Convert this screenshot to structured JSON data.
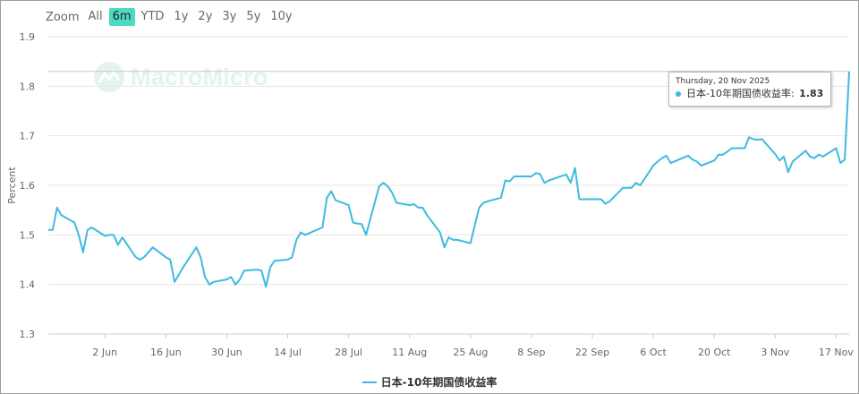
{
  "range_selector": {
    "zoom_label": "Zoom",
    "buttons": [
      "All",
      "6m",
      "YTD",
      "1y",
      "2y",
      "3y",
      "5y",
      "10y"
    ],
    "active": "6m"
  },
  "watermark": {
    "text": "MacroMicro"
  },
  "tooltip": {
    "date": "Thursday, 20 Nov 2025",
    "series_name": "日本-10年期国债收益率",
    "separator": ": ",
    "value": "1.83"
  },
  "colors": {
    "series": "#3ebae0",
    "active_button": "#4dd9c2",
    "grid": "#e6e6e6"
  },
  "chart_data": {
    "type": "line",
    "ylabel": "Percent",
    "xlabel": "",
    "ylim": [
      1.3,
      1.9
    ],
    "yticks": [
      1.3,
      1.4,
      1.5,
      1.6,
      1.7,
      1.8,
      1.9
    ],
    "grid": "horizontal",
    "legend_position": "bottom-center",
    "xlim": [
      "2025-05-20",
      "2025-11-20"
    ],
    "xticks": [
      {
        "date": "2025-06-02",
        "label": "2 Jun"
      },
      {
        "date": "2025-06-16",
        "label": "16 Jun"
      },
      {
        "date": "2025-06-30",
        "label": "30 Jun"
      },
      {
        "date": "2025-07-14",
        "label": "14 Jul"
      },
      {
        "date": "2025-07-28",
        "label": "28 Jul"
      },
      {
        "date": "2025-08-11",
        "label": "11 Aug"
      },
      {
        "date": "2025-08-25",
        "label": "25 Aug"
      },
      {
        "date": "2025-09-08",
        "label": "8 Sep"
      },
      {
        "date": "2025-09-22",
        "label": "22 Sep"
      },
      {
        "date": "2025-10-06",
        "label": "6 Oct"
      },
      {
        "date": "2025-10-20",
        "label": "20 Oct"
      },
      {
        "date": "2025-11-03",
        "label": "3 Nov"
      },
      {
        "date": "2025-11-17",
        "label": "17 Nov"
      }
    ],
    "series": [
      {
        "name": "日本-10年期国债收益率",
        "points": [
          [
            "2025-05-20",
            1.51
          ],
          [
            "2025-05-21",
            1.51
          ],
          [
            "2025-05-22",
            1.555
          ],
          [
            "2025-05-23",
            1.54
          ],
          [
            "2025-05-26",
            1.525
          ],
          [
            "2025-05-27",
            1.5
          ],
          [
            "2025-05-28",
            1.465
          ],
          [
            "2025-05-29",
            1.51
          ],
          [
            "2025-05-30",
            1.515
          ],
          [
            "2025-06-02",
            1.498
          ],
          [
            "2025-06-03",
            1.5
          ],
          [
            "2025-06-04",
            1.5
          ],
          [
            "2025-06-05",
            1.48
          ],
          [
            "2025-06-06",
            1.495
          ],
          [
            "2025-06-09",
            1.456
          ],
          [
            "2025-06-10",
            1.45
          ],
          [
            "2025-06-11",
            1.455
          ],
          [
            "2025-06-12",
            1.465
          ],
          [
            "2025-06-13",
            1.475
          ],
          [
            "2025-06-16",
            1.455
          ],
          [
            "2025-06-17",
            1.45
          ],
          [
            "2025-06-18",
            1.405
          ],
          [
            "2025-06-19",
            1.42
          ],
          [
            "2025-06-20",
            1.435
          ],
          [
            "2025-06-23",
            1.475
          ],
          [
            "2025-06-24",
            1.455
          ],
          [
            "2025-06-25",
            1.415
          ],
          [
            "2025-06-26",
            1.4
          ],
          [
            "2025-06-27",
            1.405
          ],
          [
            "2025-06-30",
            1.41
          ],
          [
            "2025-07-01",
            1.415
          ],
          [
            "2025-07-02",
            1.4
          ],
          [
            "2025-07-03",
            1.41
          ],
          [
            "2025-07-04",
            1.428
          ],
          [
            "2025-07-07",
            1.43
          ],
          [
            "2025-07-08",
            1.428
          ],
          [
            "2025-07-09",
            1.395
          ],
          [
            "2025-07-10",
            1.435
          ],
          [
            "2025-07-11",
            1.448
          ],
          [
            "2025-07-14",
            1.45
          ],
          [
            "2025-07-15",
            1.455
          ],
          [
            "2025-07-16",
            1.49
          ],
          [
            "2025-07-17",
            1.505
          ],
          [
            "2025-07-18",
            1.5
          ],
          [
            "2025-07-22",
            1.515
          ],
          [
            "2025-07-23",
            1.575
          ],
          [
            "2025-07-24",
            1.588
          ],
          [
            "2025-07-25",
            1.57
          ],
          [
            "2025-07-28",
            1.56
          ],
          [
            "2025-07-29",
            1.525
          ],
          [
            "2025-07-30",
            1.523
          ],
          [
            "2025-07-31",
            1.522
          ],
          [
            "2025-08-01",
            1.5
          ],
          [
            "2025-08-04",
            1.598
          ],
          [
            "2025-08-05",
            1.605
          ],
          [
            "2025-08-06",
            1.598
          ],
          [
            "2025-08-07",
            1.585
          ],
          [
            "2025-08-08",
            1.565
          ],
          [
            "2025-08-11",
            1.56
          ],
          [
            "2025-08-12",
            1.562
          ],
          [
            "2025-08-13",
            1.555
          ],
          [
            "2025-08-14",
            1.555
          ],
          [
            "2025-08-15",
            1.54
          ],
          [
            "2025-08-18",
            1.505
          ],
          [
            "2025-08-19",
            1.475
          ],
          [
            "2025-08-20",
            1.495
          ],
          [
            "2025-08-21",
            1.49
          ],
          [
            "2025-08-22",
            1.49
          ],
          [
            "2025-08-25",
            1.483
          ],
          [
            "2025-08-26",
            1.52
          ],
          [
            "2025-08-27",
            1.555
          ],
          [
            "2025-08-28",
            1.565
          ],
          [
            "2025-08-29",
            1.568
          ],
          [
            "2025-09-01",
            1.575
          ],
          [
            "2025-09-02",
            1.61
          ],
          [
            "2025-09-03",
            1.608
          ],
          [
            "2025-09-04",
            1.618
          ],
          [
            "2025-09-05",
            1.618
          ],
          [
            "2025-09-08",
            1.618
          ],
          [
            "2025-09-09",
            1.625
          ],
          [
            "2025-09-10",
            1.623
          ],
          [
            "2025-09-11",
            1.605
          ],
          [
            "2025-09-12",
            1.61
          ],
          [
            "2025-09-16",
            1.622
          ],
          [
            "2025-09-17",
            1.605
          ],
          [
            "2025-09-18",
            1.635
          ],
          [
            "2025-09-19",
            1.572
          ],
          [
            "2025-09-22",
            1.572
          ],
          [
            "2025-09-24",
            1.572
          ],
          [
            "2025-09-25",
            1.563
          ],
          [
            "2025-09-26",
            1.568
          ],
          [
            "2025-09-29",
            1.595
          ],
          [
            "2025-09-30",
            1.595
          ],
          [
            "2025-10-01",
            1.595
          ],
          [
            "2025-10-02",
            1.605
          ],
          [
            "2025-10-03",
            1.6
          ],
          [
            "2025-10-06",
            1.64
          ],
          [
            "2025-10-07",
            1.648
          ],
          [
            "2025-10-08",
            1.655
          ],
          [
            "2025-10-09",
            1.66
          ],
          [
            "2025-10-10",
            1.645
          ],
          [
            "2025-10-14",
            1.66
          ],
          [
            "2025-10-15",
            1.652
          ],
          [
            "2025-10-16",
            1.648
          ],
          [
            "2025-10-17",
            1.64
          ],
          [
            "2025-10-20",
            1.65
          ],
          [
            "2025-10-21",
            1.662
          ],
          [
            "2025-10-22",
            1.662
          ],
          [
            "2025-10-23",
            1.668
          ],
          [
            "2025-10-24",
            1.675
          ],
          [
            "2025-10-27",
            1.675
          ],
          [
            "2025-10-28",
            1.697
          ],
          [
            "2025-10-29",
            1.693
          ],
          [
            "2025-10-30",
            1.692
          ],
          [
            "2025-10-31",
            1.693
          ],
          [
            "2025-11-03",
            1.663
          ],
          [
            "2025-11-04",
            1.65
          ],
          [
            "2025-11-05",
            1.658
          ],
          [
            "2025-11-06",
            1.627
          ],
          [
            "2025-11-07",
            1.648
          ],
          [
            "2025-11-10",
            1.67
          ],
          [
            "2025-11-11",
            1.658
          ],
          [
            "2025-11-12",
            1.655
          ],
          [
            "2025-11-13",
            1.662
          ],
          [
            "2025-11-14",
            1.658
          ],
          [
            "2025-11-17",
            1.675
          ],
          [
            "2025-11-18",
            1.645
          ],
          [
            "2025-11-19",
            1.652
          ],
          [
            "2025-11-20",
            1.83
          ]
        ]
      }
    ]
  },
  "legend": {
    "label": "日本-10年期国债收益率"
  }
}
